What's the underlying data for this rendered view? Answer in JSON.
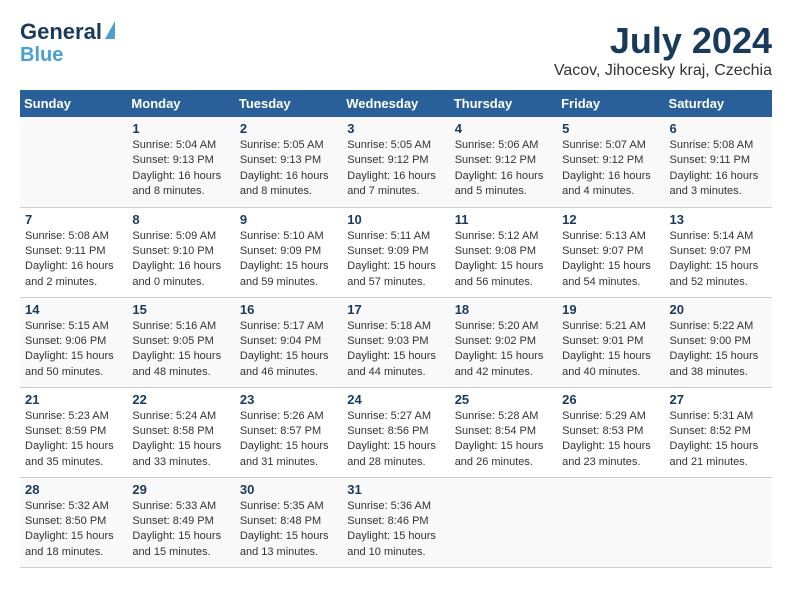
{
  "header": {
    "logo_line1": "General",
    "logo_line2": "Blue",
    "title": "July 2024",
    "subtitle": "Vacov, Jihocesky kraj, Czechia"
  },
  "columns": [
    "Sunday",
    "Monday",
    "Tuesday",
    "Wednesday",
    "Thursday",
    "Friday",
    "Saturday"
  ],
  "weeks": [
    [
      {
        "day": "",
        "info": ""
      },
      {
        "day": "1",
        "info": "Sunrise: 5:04 AM\nSunset: 9:13 PM\nDaylight: 16 hours\nand 8 minutes."
      },
      {
        "day": "2",
        "info": "Sunrise: 5:05 AM\nSunset: 9:13 PM\nDaylight: 16 hours\nand 8 minutes."
      },
      {
        "day": "3",
        "info": "Sunrise: 5:05 AM\nSunset: 9:12 PM\nDaylight: 16 hours\nand 7 minutes."
      },
      {
        "day": "4",
        "info": "Sunrise: 5:06 AM\nSunset: 9:12 PM\nDaylight: 16 hours\nand 5 minutes."
      },
      {
        "day": "5",
        "info": "Sunrise: 5:07 AM\nSunset: 9:12 PM\nDaylight: 16 hours\nand 4 minutes."
      },
      {
        "day": "6",
        "info": "Sunrise: 5:08 AM\nSunset: 9:11 PM\nDaylight: 16 hours\nand 3 minutes."
      }
    ],
    [
      {
        "day": "7",
        "info": "Sunrise: 5:08 AM\nSunset: 9:11 PM\nDaylight: 16 hours\nand 2 minutes."
      },
      {
        "day": "8",
        "info": "Sunrise: 5:09 AM\nSunset: 9:10 PM\nDaylight: 16 hours\nand 0 minutes."
      },
      {
        "day": "9",
        "info": "Sunrise: 5:10 AM\nSunset: 9:09 PM\nDaylight: 15 hours\nand 59 minutes."
      },
      {
        "day": "10",
        "info": "Sunrise: 5:11 AM\nSunset: 9:09 PM\nDaylight: 15 hours\nand 57 minutes."
      },
      {
        "day": "11",
        "info": "Sunrise: 5:12 AM\nSunset: 9:08 PM\nDaylight: 15 hours\nand 56 minutes."
      },
      {
        "day": "12",
        "info": "Sunrise: 5:13 AM\nSunset: 9:07 PM\nDaylight: 15 hours\nand 54 minutes."
      },
      {
        "day": "13",
        "info": "Sunrise: 5:14 AM\nSunset: 9:07 PM\nDaylight: 15 hours\nand 52 minutes."
      }
    ],
    [
      {
        "day": "14",
        "info": "Sunrise: 5:15 AM\nSunset: 9:06 PM\nDaylight: 15 hours\nand 50 minutes."
      },
      {
        "day": "15",
        "info": "Sunrise: 5:16 AM\nSunset: 9:05 PM\nDaylight: 15 hours\nand 48 minutes."
      },
      {
        "day": "16",
        "info": "Sunrise: 5:17 AM\nSunset: 9:04 PM\nDaylight: 15 hours\nand 46 minutes."
      },
      {
        "day": "17",
        "info": "Sunrise: 5:18 AM\nSunset: 9:03 PM\nDaylight: 15 hours\nand 44 minutes."
      },
      {
        "day": "18",
        "info": "Sunrise: 5:20 AM\nSunset: 9:02 PM\nDaylight: 15 hours\nand 42 minutes."
      },
      {
        "day": "19",
        "info": "Sunrise: 5:21 AM\nSunset: 9:01 PM\nDaylight: 15 hours\nand 40 minutes."
      },
      {
        "day": "20",
        "info": "Sunrise: 5:22 AM\nSunset: 9:00 PM\nDaylight: 15 hours\nand 38 minutes."
      }
    ],
    [
      {
        "day": "21",
        "info": "Sunrise: 5:23 AM\nSunset: 8:59 PM\nDaylight: 15 hours\nand 35 minutes."
      },
      {
        "day": "22",
        "info": "Sunrise: 5:24 AM\nSunset: 8:58 PM\nDaylight: 15 hours\nand 33 minutes."
      },
      {
        "day": "23",
        "info": "Sunrise: 5:26 AM\nSunset: 8:57 PM\nDaylight: 15 hours\nand 31 minutes."
      },
      {
        "day": "24",
        "info": "Sunrise: 5:27 AM\nSunset: 8:56 PM\nDaylight: 15 hours\nand 28 minutes."
      },
      {
        "day": "25",
        "info": "Sunrise: 5:28 AM\nSunset: 8:54 PM\nDaylight: 15 hours\nand 26 minutes."
      },
      {
        "day": "26",
        "info": "Sunrise: 5:29 AM\nSunset: 8:53 PM\nDaylight: 15 hours\nand 23 minutes."
      },
      {
        "day": "27",
        "info": "Sunrise: 5:31 AM\nSunset: 8:52 PM\nDaylight: 15 hours\nand 21 minutes."
      }
    ],
    [
      {
        "day": "28",
        "info": "Sunrise: 5:32 AM\nSunset: 8:50 PM\nDaylight: 15 hours\nand 18 minutes."
      },
      {
        "day": "29",
        "info": "Sunrise: 5:33 AM\nSunset: 8:49 PM\nDaylight: 15 hours\nand 15 minutes."
      },
      {
        "day": "30",
        "info": "Sunrise: 5:35 AM\nSunset: 8:48 PM\nDaylight: 15 hours\nand 13 minutes."
      },
      {
        "day": "31",
        "info": "Sunrise: 5:36 AM\nSunset: 8:46 PM\nDaylight: 15 hours\nand 10 minutes."
      },
      {
        "day": "",
        "info": ""
      },
      {
        "day": "",
        "info": ""
      },
      {
        "day": "",
        "info": ""
      }
    ]
  ]
}
